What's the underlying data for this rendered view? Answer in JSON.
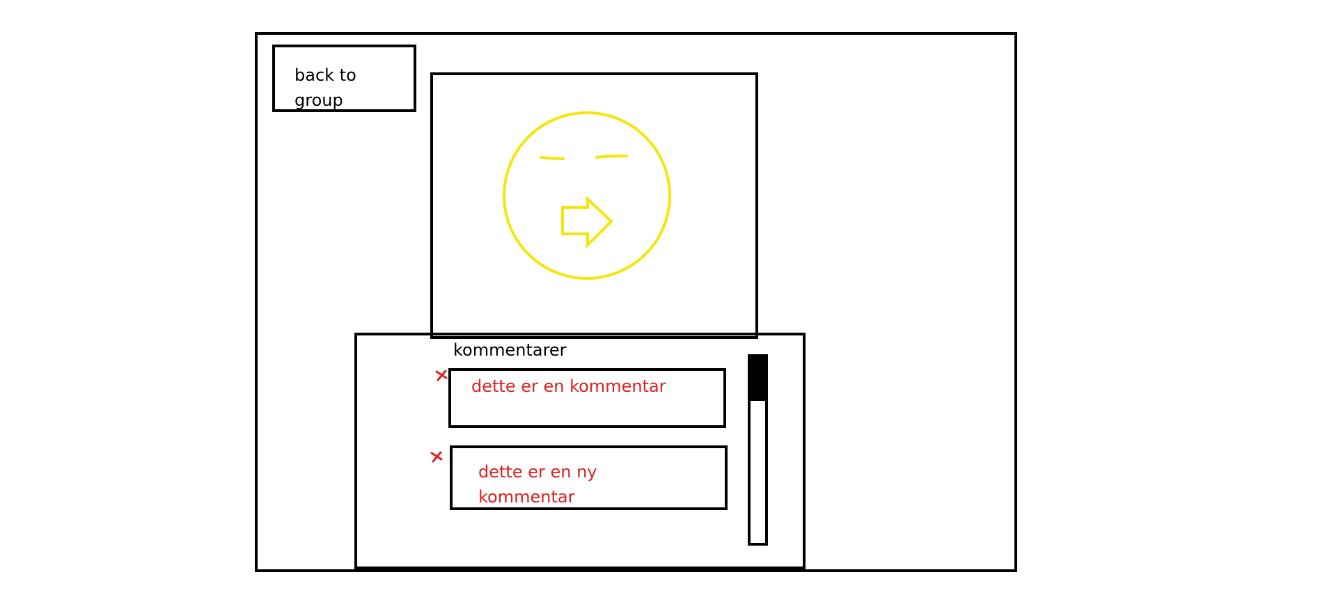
{
  "nav": {
    "back_label": "back to group"
  },
  "comments": {
    "title": "kommentarer",
    "items": [
      {
        "text": "dette er en kommentar"
      },
      {
        "text": "dette er en ny kommentar"
      }
    ],
    "scroll_position": 0
  },
  "colors": {
    "frame": "#000000",
    "comment_text": "#e0201e",
    "delete_icon": "#e0201e",
    "emoji": "#f5e60a"
  },
  "icons": {
    "delete": "close-x-icon",
    "image": "emoji-face-with-arrow-icon"
  }
}
